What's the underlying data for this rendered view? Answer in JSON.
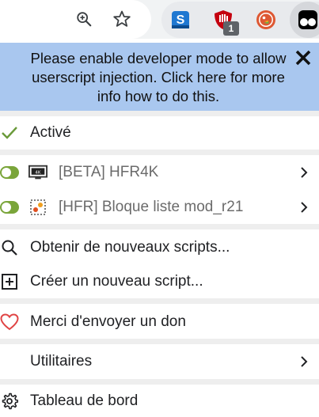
{
  "toolbar": {
    "icons": [
      "zoom-in-icon",
      "star-icon"
    ],
    "extensions": [
      "extension-s-icon",
      "ublock-origin-icon",
      "duckduckgo-icon",
      "tampermonkey-icon"
    ],
    "badge_count": "1",
    "colors": {
      "toolbar_bg": "#f1f3f4",
      "ext_group_bg": "#e8eaed"
    }
  },
  "banner": {
    "message": "Please enable developer mode to allow userscript injection. Click here for more info how to do this.",
    "close_icon": "close-icon",
    "color": "#a9c7ef"
  },
  "menu": {
    "enabled": {
      "label": "Activé",
      "icon": "check-icon"
    },
    "scripts": [
      {
        "name": "[BETA] HFR4K",
        "enabled": true,
        "icon": "hfr4k-script-icon"
      },
      {
        "name": "[HFR] Bloque liste mod_r21",
        "enabled": true,
        "icon": "bloque-liste-script-icon"
      }
    ],
    "actions": {
      "get_scripts": {
        "label": "Obtenir de nouveaux scripts...",
        "icon": "search-icon"
      },
      "new_script": {
        "label": "Créer un nouveau script...",
        "icon": "add-box-icon"
      },
      "donate": {
        "label": "Merci d'envoyer un don",
        "icon": "heart-icon"
      },
      "utilities": {
        "label": "Utilitaires"
      },
      "dashboard": {
        "label": "Tableau de bord",
        "icon": "gear-icon"
      }
    },
    "colors": {
      "toggle_on": "#7aa53a",
      "heart": "#e04444",
      "check": "#6a9a3a",
      "separator": "#eeeeee"
    }
  }
}
